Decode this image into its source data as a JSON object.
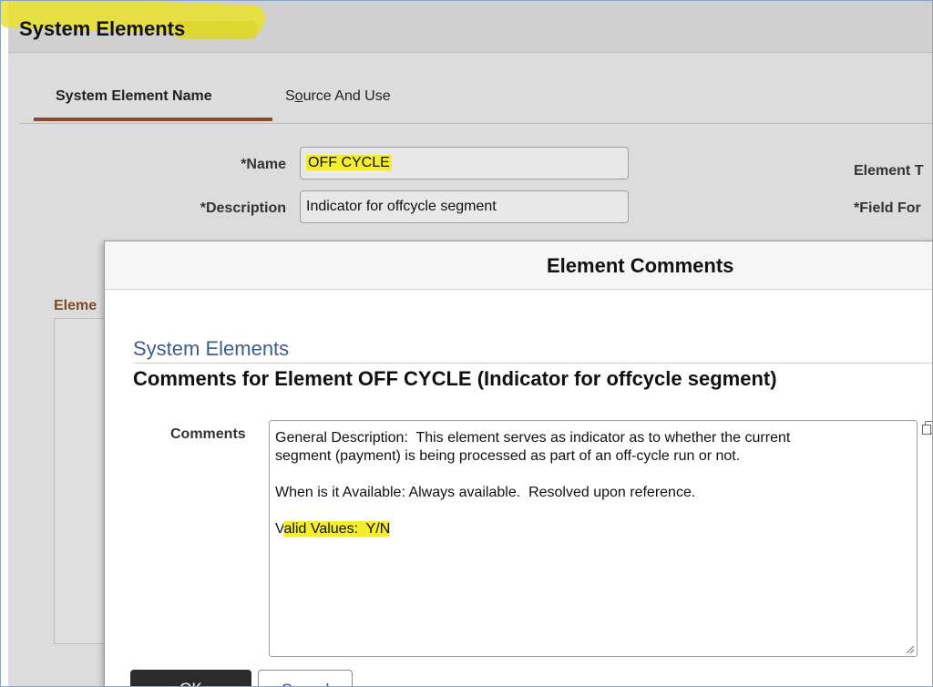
{
  "page": {
    "title": "System Elements"
  },
  "tabs": [
    {
      "label": "System Element Name",
      "active": true
    },
    {
      "label_prefix": "S",
      "label_underline": "o",
      "label_rest": "urce And Use",
      "active": false
    }
  ],
  "form": {
    "name_label": "*Name",
    "name_value": "OFF CYCLE",
    "description_label": "*Description",
    "description_value": "Indicator for offcycle segment",
    "element_type_label": "Element T",
    "field_format_label": "*Field For",
    "section_label": "Eleme"
  },
  "modal": {
    "title": "Element Comments",
    "breadcrumb": "System Elements",
    "heading": "Comments for Element OFF CYCLE (Indicator for offcycle segment)",
    "comments_label": "Comments",
    "comment_lines": {
      "l1": "General Description:  This element serves as indicator as to whether the current",
      "l2": "segment (payment) is being processed as part of an off-cycle run or not.",
      "l3": "When is it Available: Always available.  Resolved upon reference.",
      "l4_prefix": "V",
      "l4_highlight": "alid Values:  Y/N"
    },
    "ok_label": "OK",
    "cancel_label": "Cancel"
  },
  "colors": {
    "highlight": "#f4ee2a",
    "accent_tab": "#8a4a2a",
    "link_blue": "#3d5d8e",
    "primary_button": "#2b2b2b"
  }
}
